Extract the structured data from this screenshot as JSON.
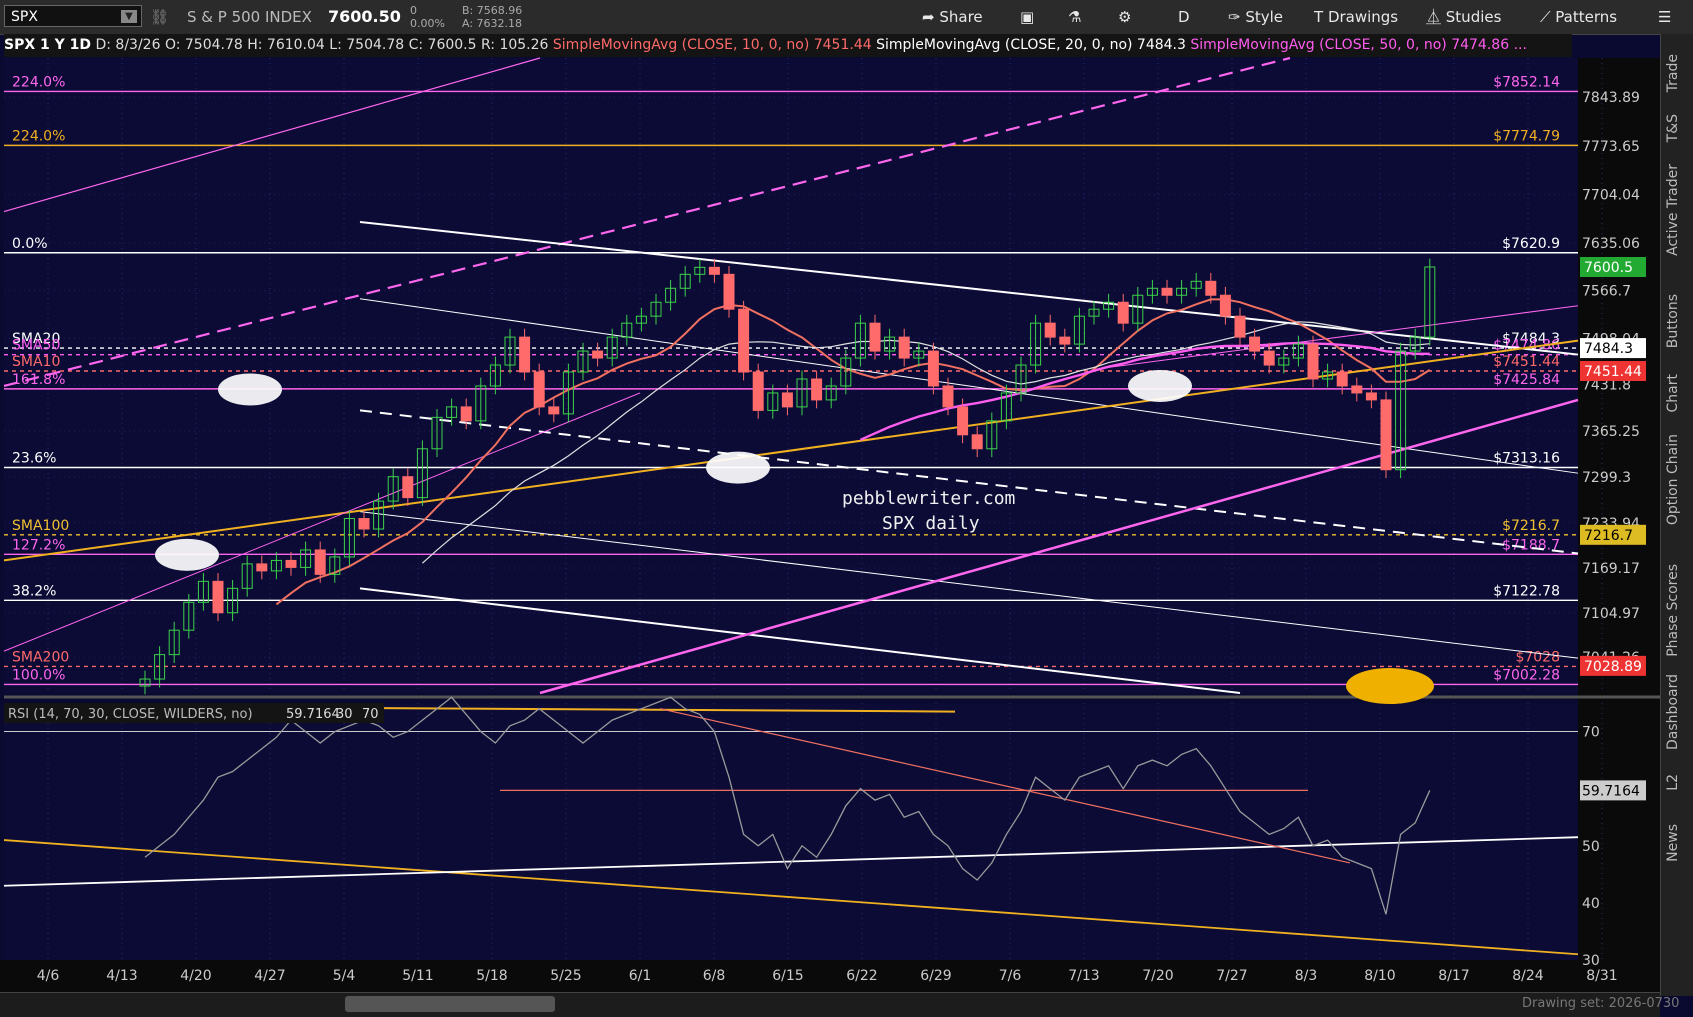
{
  "toolbar": {
    "symbol": "SPX",
    "index_name": "S & P 500 INDEX",
    "price": "7600.50",
    "change": "0",
    "change_pct": "0.00%",
    "bid": "B: 7568.96",
    "ask": "A: 7632.18",
    "share_label": "Share",
    "period_label": "D",
    "style_label": "Style",
    "drawings_label": "Drawings",
    "studies_label": "Studies",
    "patterns_label": "Patterns"
  },
  "infobar": {
    "title": "SPX 1 Y 1D",
    "date": "D: 8/3/26",
    "open": "O: 7504.78",
    "high": "H: 7610.04",
    "low": "L: 7504.78",
    "close": "C: 7600.5",
    "range": "R: 105.26",
    "sma10_label": "SimpleMovingAvg (CLOSE, 10, 0, no)",
    "sma10_value": "7451.44",
    "sma20_label": "SimpleMovingAvg (CLOSE, 20, 0, no)",
    "sma20_value": "7484.3",
    "sma50_label": "SimpleMovingAvg (CLOSE, 50, 0, no)",
    "sma50_value": "7474.86",
    "more": "..."
  },
  "sidebar": [
    "Trade",
    "T&S",
    "Active Trader",
    "Buttons",
    "Chart",
    "Option Chain",
    "Phase Scores",
    "Dashboard",
    "L2",
    "News"
  ],
  "watermark": {
    "line1": "pebblewriter.com",
    "line2": "SPX daily"
  },
  "drawing_set": "Drawing set: 2026-0730",
  "rsi_header": {
    "label": "RSI (14, 70, 30, CLOSE, WILDERS, no)",
    "value": "59.7164",
    "lo": "30",
    "hi": "70"
  },
  "colors": {
    "up": "#3cd24a",
    "down": "#ff6a6a",
    "sma10": "#f07060",
    "sma20": "#e0e0e0",
    "sma50": "#ff5cf0",
    "sma100": "#f0c030",
    "fib": "#ffffff",
    "pink": "#ff66ee",
    "gold": "#f0b020"
  },
  "chart_data": [
    {
      "type": "candlestick",
      "title": "SPX 1 Y 1D",
      "x": [
        "4/6",
        "4/13",
        "4/20",
        "4/27",
        "5/4",
        "5/11",
        "5/18",
        "5/25",
        "6/1",
        "6/8",
        "6/15",
        "6/22",
        "6/29",
        "7/6",
        "7/13",
        "7/20",
        "7/27",
        "8/3",
        "8/10",
        "8/17",
        "8/24",
        "8/31"
      ],
      "ylim": [
        6990,
        7900
      ],
      "y_ticks": [
        "7843.89",
        "7773.65",
        "7704.04",
        "7635.06",
        "7566.7",
        "7498.04",
        "7431.8",
        "7365.25",
        "7299.3",
        "7233.94",
        "7169.17",
        "7104.97",
        "7041.26"
      ],
      "closes": [
        7010,
        7045,
        7080,
        7120,
        7150,
        7105,
        7140,
        7175,
        7165,
        7180,
        7170,
        7195,
        7160,
        7185,
        7240,
        7225,
        7265,
        7300,
        7270,
        7340,
        7385,
        7400,
        7380,
        7430,
        7460,
        7500,
        7450,
        7400,
        7390,
        7450,
        7480,
        7470,
        7500,
        7520,
        7530,
        7550,
        7570,
        7590,
        7600,
        7590,
        7540,
        7450,
        7395,
        7420,
        7400,
        7440,
        7410,
        7430,
        7470,
        7520,
        7480,
        7500,
        7470,
        7480,
        7430,
        7400,
        7360,
        7340,
        7380,
        7420,
        7460,
        7520,
        7500,
        7490,
        7530,
        7540,
        7550,
        7520,
        7560,
        7570,
        7560,
        7570,
        7580,
        7560,
        7530,
        7500,
        7480,
        7460,
        7470,
        7490,
        7440,
        7450,
        7430,
        7420,
        7410,
        7310,
        7480,
        7500,
        7600.5
      ],
      "annotations": [
        "pebblewriter.com",
        "SPX daily"
      ],
      "levels": [
        {
          "label": "224.0%",
          "value": 7852.14,
          "price": "$7852.14"
        },
        {
          "label": "224.0%",
          "value": 7774.79,
          "price": "$7774.79"
        },
        {
          "label": "0.0%",
          "value": 7620.9,
          "price": "$7620.9"
        },
        {
          "label": "SMA20",
          "value": 7484.3,
          "price": "$7484.3"
        },
        {
          "label": "SMA50",
          "value": 7474.86,
          "price": "$7474.86"
        },
        {
          "label": "SMA10",
          "value": 7451.44,
          "price": "$7451.44"
        },
        {
          "label": "161.8%",
          "value": 7425.84,
          "price": "$7425.84"
        },
        {
          "label": "23.6%",
          "value": 7313.16,
          "price": "$7313.16"
        },
        {
          "label": "SMA100",
          "value": 7216.7,
          "price": "$7216.7"
        },
        {
          "label": "127.2%",
          "value": 7188.7,
          "price": "$7188.7"
        },
        {
          "label": "38.2%",
          "value": 7122.78,
          "price": "$7122.78"
        },
        {
          "label": "SMA200",
          "value": 7028,
          "price": "$7028"
        },
        {
          "label": "100.0%",
          "value": 7002.28,
          "price": "$7002.28"
        }
      ],
      "price_tags": [
        {
          "text": "7600.5",
          "value": 7600.5,
          "color": "#22aa33"
        },
        {
          "text": "7484.3",
          "value": 7484.3,
          "color": "#ffffff"
        },
        {
          "text": "7451.44",
          "value": 7451.44,
          "color": "#ee3333"
        },
        {
          "text": "7216.7",
          "value": 7216.7,
          "color": "#ddbb22"
        },
        {
          "text": "7028.89",
          "value": 7028.89,
          "color": "#ee3333"
        }
      ]
    },
    {
      "type": "line",
      "title": "RSI (14, 70, 30, CLOSE, WILDERS, no)",
      "ylim": [
        30,
        75
      ],
      "y_ticks": [
        "70",
        "60",
        "50",
        "40",
        "30"
      ],
      "series": [
        {
          "name": "RSI",
          "values": [
            48,
            50,
            52,
            55,
            58,
            62,
            63,
            65,
            67,
            69,
            72,
            70,
            68,
            70,
            71,
            72,
            71,
            69,
            70,
            72,
            74,
            76,
            73,
            70,
            68,
            71,
            72,
            74,
            72,
            70,
            68,
            70,
            72,
            73,
            74,
            75,
            76,
            74,
            73,
            70,
            62,
            52,
            50,
            52,
            46,
            50,
            48,
            52,
            57,
            60,
            58,
            59,
            55,
            56,
            52,
            50,
            46,
            44,
            47,
            52,
            56,
            62,
            60,
            58,
            62,
            63,
            64,
            60,
            64,
            65,
            64,
            66,
            67,
            64,
            60,
            56,
            54,
            52,
            53,
            55,
            50,
            51,
            48,
            47,
            46,
            38,
            52,
            54,
            59.7164
          ]
        }
      ],
      "current_tag": "59.7164"
    }
  ]
}
